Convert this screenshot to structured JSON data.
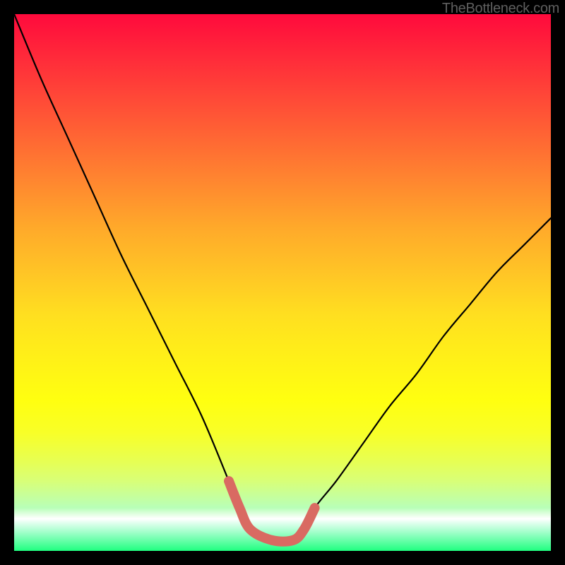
{
  "watermark": "TheBottleneck.com",
  "chart_data": {
    "type": "line",
    "title": "",
    "xlabel": "",
    "ylabel": "",
    "xlim": [
      0,
      100
    ],
    "ylim": [
      0,
      100
    ],
    "grid": false,
    "legend": false,
    "series": [
      {
        "name": "bottleneck-curve",
        "color": "#000000",
        "x": [
          0,
          5,
          10,
          15,
          20,
          25,
          30,
          35,
          40,
          42,
          44,
          48,
          52,
          54,
          56,
          60,
          65,
          70,
          75,
          80,
          85,
          90,
          95,
          100
        ],
        "values": [
          100,
          88,
          77,
          66,
          55,
          45,
          35,
          25,
          13,
          8,
          4,
          2,
          2,
          4,
          8,
          13,
          20,
          27,
          33,
          40,
          46,
          52,
          57,
          62
        ]
      },
      {
        "name": "highlight-segment",
        "color": "#d96a62",
        "x": [
          40,
          42,
          44,
          48,
          52,
          54,
          56
        ],
        "values": [
          13,
          8,
          4,
          2,
          2,
          4,
          8
        ]
      }
    ],
    "gradient_stops": [
      {
        "pos": 0,
        "color": "#ff0a3c"
      },
      {
        "pos": 50,
        "color": "#ffd020"
      },
      {
        "pos": 80,
        "color": "#ffff20"
      },
      {
        "pos": 94,
        "color": "#ffffff"
      },
      {
        "pos": 100,
        "color": "#20ff80"
      }
    ]
  }
}
